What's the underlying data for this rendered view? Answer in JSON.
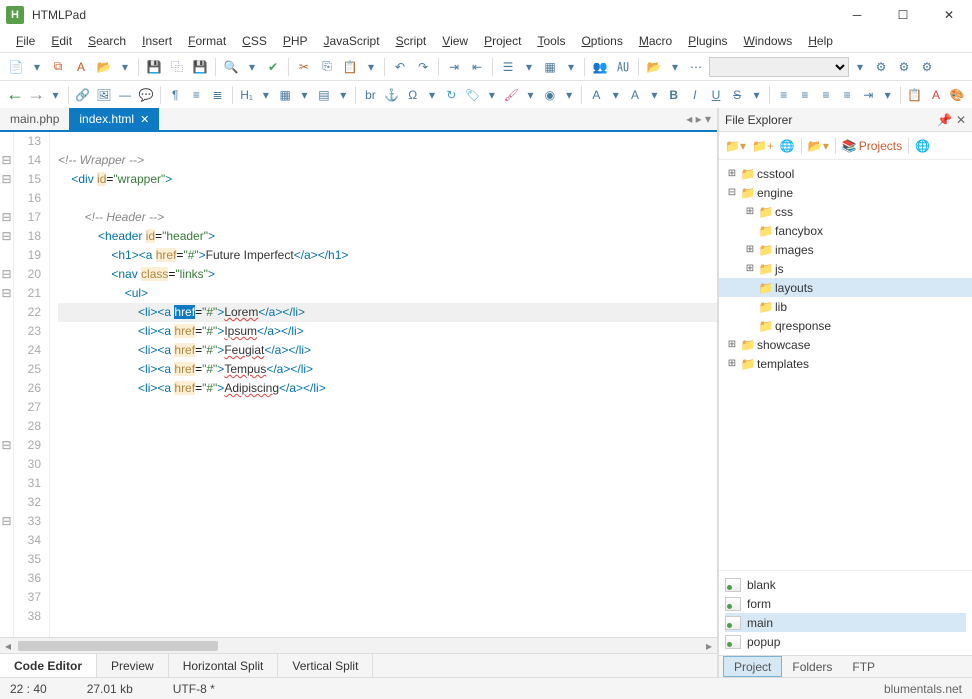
{
  "app": {
    "title": "HTMLPad",
    "icon_letter": "H"
  },
  "menus": [
    "File",
    "Edit",
    "Search",
    "Insert",
    "Format",
    "CSS",
    "PHP",
    "JavaScript",
    "Script",
    "View",
    "Project",
    "Tools",
    "Options",
    "Macro",
    "Plugins",
    "Windows",
    "Help"
  ],
  "tabs": [
    {
      "label": "main.php",
      "active": false
    },
    {
      "label": "index.html",
      "active": true
    }
  ],
  "code_start_line": 13,
  "code_lines": [
    {
      "n": 13,
      "fold": "",
      "html": ""
    },
    {
      "n": 14,
      "fold": "⊟",
      "html": "<span class='cm'>&lt;!-- Wrapper --&gt;</span>"
    },
    {
      "n": 15,
      "fold": "⊟",
      "html": "    <span class='tg'>&lt;div</span> <span class='at'>id</span>=<span class='st'>\"wrapper\"</span><span class='tg'>&gt;</span>"
    },
    {
      "n": 16,
      "fold": "",
      "html": ""
    },
    {
      "n": 17,
      "fold": "⊟",
      "html": "        <span class='cm'>&lt;!-- Header --&gt;</span>"
    },
    {
      "n": 18,
      "fold": "⊟",
      "html": "            <span class='tg'>&lt;header</span> <span class='at'>id</span>=<span class='st'>\"header\"</span><span class='tg'>&gt;</span>"
    },
    {
      "n": 19,
      "fold": "",
      "html": "                <span class='tg'>&lt;h1&gt;&lt;a</span> <span class='at'>href</span>=<span class='st'>\"#\"</span><span class='tg'>&gt;</span><span class='tx'>Future Imperfect</span><span class='tg'>&lt;/a&gt;&lt;/h1&gt;</span>"
    },
    {
      "n": 20,
      "fold": "⊟",
      "html": "                <span class='tg'>&lt;nav</span> <span class='at'>class</span>=<span class='st'>\"links\"</span><span class='tg'>&gt;</span>"
    },
    {
      "n": 21,
      "fold": "⊟",
      "html": "                    <span class='tg'>&lt;ul&gt;</span>"
    },
    {
      "n": 22,
      "fold": "",
      "hl": true,
      "html": "                        <span class='tg'>&lt;li&gt;&lt;a</span> <span class='at-sel'>href</span>=<span class='st'>\"#\"</span><span class='tg'>&gt;</span><span class='tx wavy'>Lorem</span><span class='tg'>&lt;/a&gt;&lt;/li&gt;</span>"
    },
    {
      "n": 23,
      "fold": "",
      "html": "                        <span class='tg'>&lt;li&gt;&lt;a</span> <span class='at'>href</span>=<span class='st'>\"#\"</span><span class='tg'>&gt;</span><span class='tx wavy'>Ipsum</span><span class='tg'>&lt;/a&gt;&lt;/li&gt;</span>"
    },
    {
      "n": 24,
      "fold": "",
      "html": "                        <span class='tg'>&lt;li&gt;&lt;a</span> <span class='at'>href</span>=<span class='st'>\"#\"</span><span class='tg'>&gt;</span><span class='tx wavy'>Feugiat</span><span class='tg'>&lt;/a&gt;&lt;/li&gt;</span>"
    },
    {
      "n": 25,
      "fold": "",
      "html": "                        <span class='tg'>&lt;li&gt;&lt;a</span> <span class='at'>href</span>=<span class='st'>\"#\"</span><span class='tg'>&gt;</span><span class='tx wavy'>Tempus</span><span class='tg'>&lt;/a&gt;&lt;/li&gt;</span>"
    },
    {
      "n": 26,
      "fold": "",
      "html": "                        <span class='tg'>&lt;li&gt;&lt;a</span> <span class='at'>href</span>=<span class='st'>\"#\"</span><span class='tg'>&gt;</span><span class='tx wavy'>Adipiscing</span><span class='tg'>&lt;/a&gt;&lt;/li&gt;</span>"
    },
    {
      "n": 27,
      "fold": "",
      "html": ""
    },
    {
      "n": 28,
      "fold": "",
      "html": ""
    },
    {
      "n": 29,
      "fold": "⊟",
      "html": ""
    },
    {
      "n": 30,
      "fold": "",
      "html": ""
    },
    {
      "n": 31,
      "fold": "",
      "html": ""
    },
    {
      "n": 32,
      "fold": "",
      "html": ""
    },
    {
      "n": 33,
      "fold": "⊟",
      "html": ""
    },
    {
      "n": 34,
      "fold": "",
      "html": ""
    },
    {
      "n": 35,
      "fold": "",
      "html": ""
    },
    {
      "n": 36,
      "fold": "",
      "html": ""
    },
    {
      "n": 37,
      "fold": "",
      "html": ""
    },
    {
      "n": 38,
      "fold": "",
      "html": ""
    }
  ],
  "bottom_tabs": [
    "Code Editor",
    "Preview",
    "Horizontal Split",
    "Vertical Split"
  ],
  "file_explorer": {
    "title": "File Explorer",
    "projects_label": "Projects",
    "tree": [
      {
        "depth": 0,
        "exp": "⊞",
        "ico": "green-dot",
        "label": "csstool"
      },
      {
        "depth": 0,
        "exp": "⊟",
        "ico": "red-dot",
        "label": "engine"
      },
      {
        "depth": 1,
        "exp": "⊞",
        "ico": "green-dot",
        "label": "css"
      },
      {
        "depth": 1,
        "exp": "",
        "ico": "green-dot",
        "label": "fancybox"
      },
      {
        "depth": 1,
        "exp": "⊞",
        "ico": "green-dot",
        "label": "images"
      },
      {
        "depth": 1,
        "exp": "⊞",
        "ico": "green-dot",
        "label": "js"
      },
      {
        "depth": 1,
        "exp": "",
        "ico": "green-dot",
        "label": "layouts",
        "sel": true
      },
      {
        "depth": 1,
        "exp": "",
        "ico": "green-dot",
        "label": "lib"
      },
      {
        "depth": 1,
        "exp": "",
        "ico": "folder-ico",
        "label": "qresponse"
      },
      {
        "depth": 0,
        "exp": "⊞",
        "ico": "green-dot",
        "label": "showcase"
      },
      {
        "depth": 0,
        "exp": "⊞",
        "ico": "red-dot",
        "label": "templates"
      }
    ],
    "files": [
      "blank",
      "form",
      "main",
      "popup"
    ],
    "file_selected": "main",
    "tabs": [
      "Project",
      "Folders",
      "FTP"
    ]
  },
  "status": {
    "pos": "22 : 40",
    "size": "27.01 kb",
    "enc": "UTF-8 *",
    "site": "blumentals.net"
  }
}
